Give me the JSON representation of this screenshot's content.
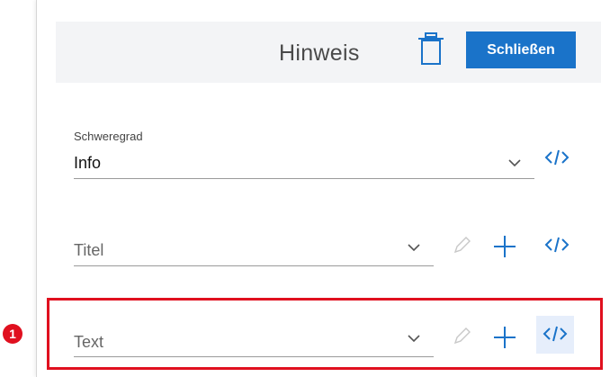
{
  "header": {
    "title": "Hinweis",
    "close_label": "Schließen"
  },
  "severity": {
    "label": "Schweregrad",
    "value": "Info"
  },
  "title_field": {
    "placeholder": "Titel"
  },
  "text_field": {
    "placeholder": "Text"
  },
  "callout": {
    "number": "1"
  },
  "colors": {
    "accent": "#1a73c9",
    "highlight": "#e0101f",
    "header_bg": "#f3f4f6"
  },
  "icons": {
    "delete": "trash-icon",
    "dropdown": "chevron-down-icon",
    "code": "code-icon",
    "edit": "pencil-icon",
    "add": "plus-icon"
  }
}
